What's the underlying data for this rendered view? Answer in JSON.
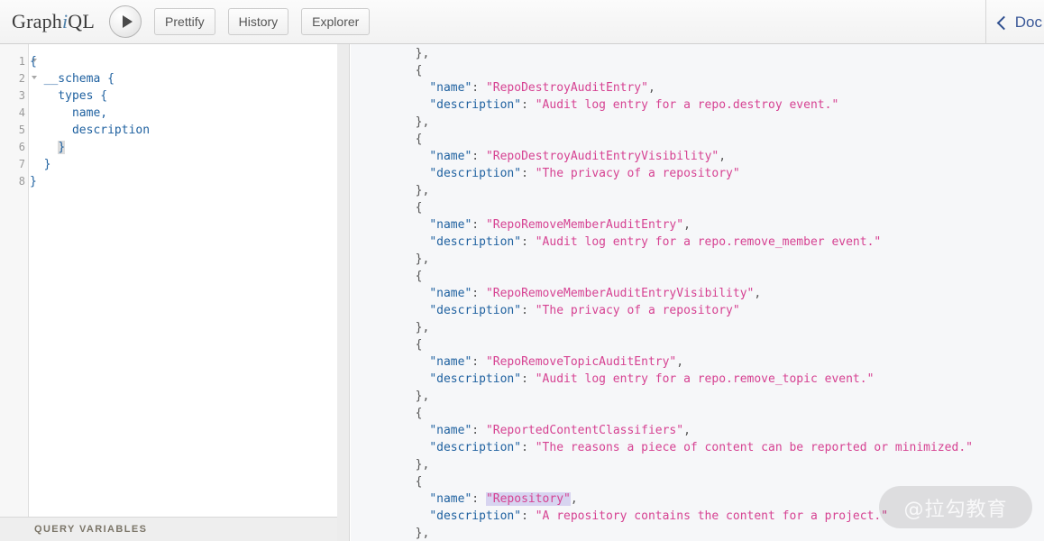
{
  "toolbar": {
    "logo_pre": "Graph",
    "logo_i": "i",
    "logo_post": "QL",
    "execute_label": "",
    "buttons": [
      {
        "label": "Prettify"
      },
      {
        "label": "History"
      },
      {
        "label": "Explorer"
      }
    ],
    "docs_label": "Doc"
  },
  "editor": {
    "gutter_lines": [
      "1",
      "2",
      "3",
      "4",
      "5",
      "6",
      "7",
      "8"
    ],
    "folded": [
      true,
      true,
      false,
      false,
      false,
      false,
      false,
      false
    ],
    "lines": [
      "{",
      "  __schema {",
      "    types {",
      "      name,",
      "      description",
      "    }",
      "  }",
      "}"
    ]
  },
  "query_variables": {
    "label": "QUERY VARIABLES"
  },
  "results": {
    "lines": [
      {
        "parts": [
          {
            "t": "  },",
            "c": "jp"
          }
        ]
      },
      {
        "parts": [
          {
            "t": "  {",
            "c": "jp"
          }
        ]
      },
      {
        "parts": [
          {
            "t": "    ",
            "c": "jp"
          },
          {
            "t": "\"name\"",
            "c": "jk"
          },
          {
            "t": ": ",
            "c": "jp"
          },
          {
            "t": "\"RepoDestroyAuditEntry\"",
            "c": "jv"
          },
          {
            "t": ",",
            "c": "jp"
          }
        ]
      },
      {
        "parts": [
          {
            "t": "    ",
            "c": "jp"
          },
          {
            "t": "\"description\"",
            "c": "jk"
          },
          {
            "t": ": ",
            "c": "jp"
          },
          {
            "t": "\"Audit log entry for a repo.destroy event.\"",
            "c": "jv"
          }
        ]
      },
      {
        "parts": [
          {
            "t": "  },",
            "c": "jp"
          }
        ]
      },
      {
        "parts": [
          {
            "t": "  {",
            "c": "jp"
          }
        ]
      },
      {
        "parts": [
          {
            "t": "    ",
            "c": "jp"
          },
          {
            "t": "\"name\"",
            "c": "jk"
          },
          {
            "t": ": ",
            "c": "jp"
          },
          {
            "t": "\"RepoDestroyAuditEntryVisibility\"",
            "c": "jv"
          },
          {
            "t": ",",
            "c": "jp"
          }
        ]
      },
      {
        "parts": [
          {
            "t": "    ",
            "c": "jp"
          },
          {
            "t": "\"description\"",
            "c": "jk"
          },
          {
            "t": ": ",
            "c": "jp"
          },
          {
            "t": "\"The privacy of a repository\"",
            "c": "jv"
          }
        ]
      },
      {
        "parts": [
          {
            "t": "  },",
            "c": "jp"
          }
        ]
      },
      {
        "parts": [
          {
            "t": "  {",
            "c": "jp"
          }
        ]
      },
      {
        "parts": [
          {
            "t": "    ",
            "c": "jp"
          },
          {
            "t": "\"name\"",
            "c": "jk"
          },
          {
            "t": ": ",
            "c": "jp"
          },
          {
            "t": "\"RepoRemoveMemberAuditEntry\"",
            "c": "jv"
          },
          {
            "t": ",",
            "c": "jp"
          }
        ]
      },
      {
        "parts": [
          {
            "t": "    ",
            "c": "jp"
          },
          {
            "t": "\"description\"",
            "c": "jk"
          },
          {
            "t": ": ",
            "c": "jp"
          },
          {
            "t": "\"Audit log entry for a repo.remove_member event.\"",
            "c": "jv"
          }
        ]
      },
      {
        "parts": [
          {
            "t": "  },",
            "c": "jp"
          }
        ]
      },
      {
        "parts": [
          {
            "t": "  {",
            "c": "jp"
          }
        ]
      },
      {
        "parts": [
          {
            "t": "    ",
            "c": "jp"
          },
          {
            "t": "\"name\"",
            "c": "jk"
          },
          {
            "t": ": ",
            "c": "jp"
          },
          {
            "t": "\"RepoRemoveMemberAuditEntryVisibility\"",
            "c": "jv"
          },
          {
            "t": ",",
            "c": "jp"
          }
        ]
      },
      {
        "parts": [
          {
            "t": "    ",
            "c": "jp"
          },
          {
            "t": "\"description\"",
            "c": "jk"
          },
          {
            "t": ": ",
            "c": "jp"
          },
          {
            "t": "\"The privacy of a repository\"",
            "c": "jv"
          }
        ]
      },
      {
        "parts": [
          {
            "t": "  },",
            "c": "jp"
          }
        ]
      },
      {
        "parts": [
          {
            "t": "  {",
            "c": "jp"
          }
        ]
      },
      {
        "parts": [
          {
            "t": "    ",
            "c": "jp"
          },
          {
            "t": "\"name\"",
            "c": "jk"
          },
          {
            "t": ": ",
            "c": "jp"
          },
          {
            "t": "\"RepoRemoveTopicAuditEntry\"",
            "c": "jv"
          },
          {
            "t": ",",
            "c": "jp"
          }
        ]
      },
      {
        "parts": [
          {
            "t": "    ",
            "c": "jp"
          },
          {
            "t": "\"description\"",
            "c": "jk"
          },
          {
            "t": ": ",
            "c": "jp"
          },
          {
            "t": "\"Audit log entry for a repo.remove_topic event.\"",
            "c": "jv"
          }
        ]
      },
      {
        "parts": [
          {
            "t": "  },",
            "c": "jp"
          }
        ]
      },
      {
        "parts": [
          {
            "t": "  {",
            "c": "jp"
          }
        ]
      },
      {
        "parts": [
          {
            "t": "    ",
            "c": "jp"
          },
          {
            "t": "\"name\"",
            "c": "jk"
          },
          {
            "t": ": ",
            "c": "jp"
          },
          {
            "t": "\"ReportedContentClassifiers\"",
            "c": "jv"
          },
          {
            "t": ",",
            "c": "jp"
          }
        ]
      },
      {
        "parts": [
          {
            "t": "    ",
            "c": "jp"
          },
          {
            "t": "\"description\"",
            "c": "jk"
          },
          {
            "t": ": ",
            "c": "jp"
          },
          {
            "t": "\"The reasons a piece of content can be reported or minimized.\"",
            "c": "jv"
          }
        ]
      },
      {
        "parts": [
          {
            "t": "  },",
            "c": "jp"
          }
        ]
      },
      {
        "parts": [
          {
            "t": "  {",
            "c": "jp"
          }
        ]
      },
      {
        "parts": [
          {
            "t": "    ",
            "c": "jp"
          },
          {
            "t": "\"name\"",
            "c": "jk"
          },
          {
            "t": ": ",
            "c": "jp"
          },
          {
            "t": "\"Repository\"",
            "c": "jv sel"
          },
          {
            "t": ",",
            "c": "jp"
          }
        ]
      },
      {
        "parts": [
          {
            "t": "    ",
            "c": "jp"
          },
          {
            "t": "\"description\"",
            "c": "jk"
          },
          {
            "t": ": ",
            "c": "jp"
          },
          {
            "t": "\"A repository contains the content for a project.\"",
            "c": "jv"
          }
        ]
      },
      {
        "parts": [
          {
            "t": "  },",
            "c": "jp"
          }
        ]
      }
    ]
  },
  "watermark": {
    "text": "@拉勾教育"
  }
}
